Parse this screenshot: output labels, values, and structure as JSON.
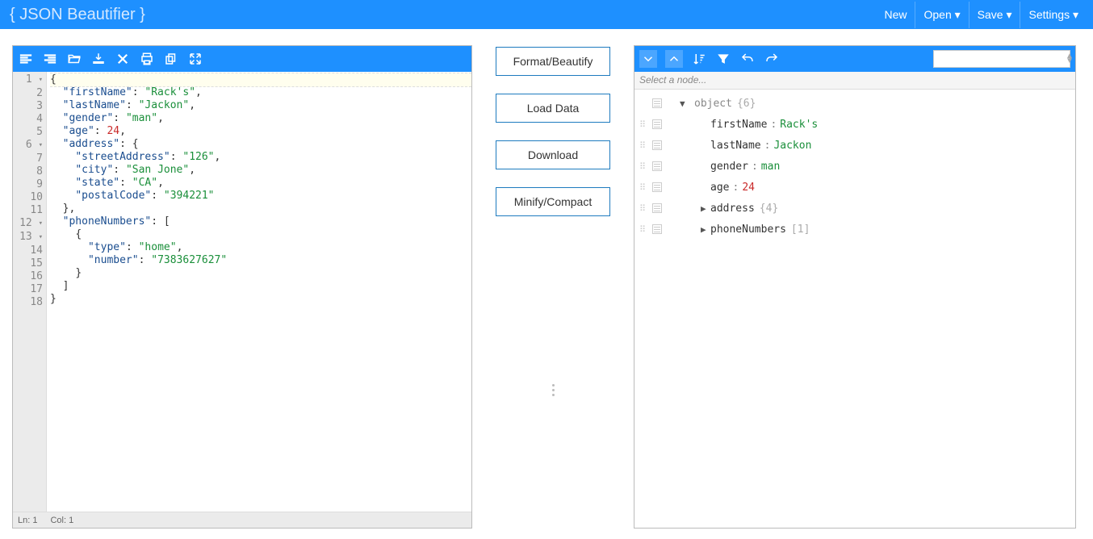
{
  "header": {
    "title": "{ JSON Beautifier }",
    "menu": [
      "New",
      "Open ▾",
      "Save ▾",
      "Settings ▾"
    ]
  },
  "actions": {
    "format": "Format/Beautify",
    "load": "Load Data",
    "download": "Download",
    "minify": "Minify/Compact"
  },
  "left_toolbar_icons": [
    "align-left",
    "align-right",
    "folder-open",
    "download",
    "close",
    "print",
    "copy",
    "fullscreen"
  ],
  "right_toolbar_icons": [
    "chevron-down-box",
    "chevron-up-box",
    "sort",
    "filter",
    "undo",
    "redo"
  ],
  "editor": {
    "lines": [
      {
        "n": 1,
        "fold": true,
        "hl": true,
        "tokens": [
          {
            "t": "punc",
            "v": "{"
          }
        ]
      },
      {
        "n": 2,
        "tokens": [
          {
            "t": "sp",
            "v": "  "
          },
          {
            "t": "key",
            "v": "\"firstName\""
          },
          {
            "t": "punc",
            "v": ": "
          },
          {
            "t": "str",
            "v": "\"Rack's\""
          },
          {
            "t": "punc",
            "v": ","
          }
        ]
      },
      {
        "n": 3,
        "tokens": [
          {
            "t": "sp",
            "v": "  "
          },
          {
            "t": "key",
            "v": "\"lastName\""
          },
          {
            "t": "punc",
            "v": ": "
          },
          {
            "t": "str",
            "v": "\"Jackon\""
          },
          {
            "t": "punc",
            "v": ","
          }
        ]
      },
      {
        "n": 4,
        "tokens": [
          {
            "t": "sp",
            "v": "  "
          },
          {
            "t": "key",
            "v": "\"gender\""
          },
          {
            "t": "punc",
            "v": ": "
          },
          {
            "t": "str",
            "v": "\"man\""
          },
          {
            "t": "punc",
            "v": ","
          }
        ]
      },
      {
        "n": 5,
        "tokens": [
          {
            "t": "sp",
            "v": "  "
          },
          {
            "t": "key",
            "v": "\"age\""
          },
          {
            "t": "punc",
            "v": ": "
          },
          {
            "t": "num",
            "v": "24"
          },
          {
            "t": "punc",
            "v": ","
          }
        ]
      },
      {
        "n": 6,
        "fold": true,
        "tokens": [
          {
            "t": "sp",
            "v": "  "
          },
          {
            "t": "key",
            "v": "\"address\""
          },
          {
            "t": "punc",
            "v": ": {"
          }
        ]
      },
      {
        "n": 7,
        "tokens": [
          {
            "t": "sp",
            "v": "    "
          },
          {
            "t": "key",
            "v": "\"streetAddress\""
          },
          {
            "t": "punc",
            "v": ": "
          },
          {
            "t": "str",
            "v": "\"126\""
          },
          {
            "t": "punc",
            "v": ","
          }
        ]
      },
      {
        "n": 8,
        "tokens": [
          {
            "t": "sp",
            "v": "    "
          },
          {
            "t": "key",
            "v": "\"city\""
          },
          {
            "t": "punc",
            "v": ": "
          },
          {
            "t": "str",
            "v": "\"San Jone\""
          },
          {
            "t": "punc",
            "v": ","
          }
        ]
      },
      {
        "n": 9,
        "tokens": [
          {
            "t": "sp",
            "v": "    "
          },
          {
            "t": "key",
            "v": "\"state\""
          },
          {
            "t": "punc",
            "v": ": "
          },
          {
            "t": "str",
            "v": "\"CA\""
          },
          {
            "t": "punc",
            "v": ","
          }
        ]
      },
      {
        "n": 10,
        "tokens": [
          {
            "t": "sp",
            "v": "    "
          },
          {
            "t": "key",
            "v": "\"postalCode\""
          },
          {
            "t": "punc",
            "v": ": "
          },
          {
            "t": "str",
            "v": "\"394221\""
          }
        ]
      },
      {
        "n": 11,
        "tokens": [
          {
            "t": "sp",
            "v": "  "
          },
          {
            "t": "punc",
            "v": "},"
          }
        ]
      },
      {
        "n": 12,
        "fold": true,
        "tokens": [
          {
            "t": "sp",
            "v": "  "
          },
          {
            "t": "key",
            "v": "\"phoneNumbers\""
          },
          {
            "t": "punc",
            "v": ": ["
          }
        ]
      },
      {
        "n": 13,
        "fold": true,
        "tokens": [
          {
            "t": "sp",
            "v": "    "
          },
          {
            "t": "punc",
            "v": "{"
          }
        ]
      },
      {
        "n": 14,
        "tokens": [
          {
            "t": "sp",
            "v": "      "
          },
          {
            "t": "key",
            "v": "\"type\""
          },
          {
            "t": "punc",
            "v": ": "
          },
          {
            "t": "str",
            "v": "\"home\""
          },
          {
            "t": "punc",
            "v": ","
          }
        ]
      },
      {
        "n": 15,
        "tokens": [
          {
            "t": "sp",
            "v": "      "
          },
          {
            "t": "key",
            "v": "\"number\""
          },
          {
            "t": "punc",
            "v": ": "
          },
          {
            "t": "str",
            "v": "\"7383627627\""
          }
        ]
      },
      {
        "n": 16,
        "tokens": [
          {
            "t": "sp",
            "v": "    "
          },
          {
            "t": "punc",
            "v": "}"
          }
        ]
      },
      {
        "n": 17,
        "tokens": [
          {
            "t": "sp",
            "v": "  "
          },
          {
            "t": "punc",
            "v": "]"
          }
        ]
      },
      {
        "n": 18,
        "tokens": [
          {
            "t": "punc",
            "v": "}"
          }
        ]
      }
    ],
    "status": {
      "ln": "Ln: 1",
      "col": "Col: 1"
    }
  },
  "breadcrumb": "Select a node...",
  "tree": [
    {
      "indent": 0,
      "arrow": "▼",
      "label": "object",
      "meta": "{6}",
      "nodrag": true,
      "type": "obj"
    },
    {
      "indent": 1,
      "key": "firstName",
      "val": "Rack's",
      "vtype": "str"
    },
    {
      "indent": 1,
      "key": "lastName",
      "val": "Jackon",
      "vtype": "str"
    },
    {
      "indent": 1,
      "key": "gender",
      "val": "man",
      "vtype": "str"
    },
    {
      "indent": 1,
      "key": "age",
      "val": "24",
      "vtype": "num"
    },
    {
      "indent": 1,
      "arrow": "▶",
      "key": "address",
      "meta": "{4}",
      "type": "obj"
    },
    {
      "indent": 1,
      "arrow": "▶",
      "key": "phoneNumbers",
      "meta": "[1]",
      "type": "arr"
    }
  ]
}
